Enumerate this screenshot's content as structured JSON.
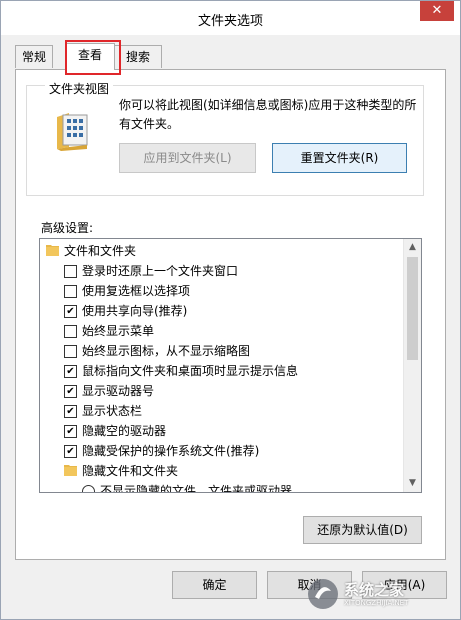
{
  "window": {
    "title": "文件夹选项",
    "close_glyph": "✕"
  },
  "tabs": [
    {
      "label": "常规",
      "active": false
    },
    {
      "label": "查看",
      "active": true
    },
    {
      "label": "搜索",
      "active": false
    }
  ],
  "folder_view": {
    "caption": "文件夹视图",
    "description": "你可以将此视图(如详细信息或图标)应用于这种类型的所有文件夹。",
    "apply_button": "应用到文件夹(L)",
    "reset_button": "重置文件夹(R)"
  },
  "advanced": {
    "label": "高级设置:",
    "items": [
      {
        "type": "folder",
        "indent": 0,
        "label": "文件和文件夹"
      },
      {
        "type": "checkbox",
        "indent": 1,
        "checked": false,
        "label": "登录时还原上一个文件夹窗口"
      },
      {
        "type": "checkbox",
        "indent": 1,
        "checked": false,
        "label": "使用复选框以选择项"
      },
      {
        "type": "checkbox",
        "indent": 1,
        "checked": true,
        "label": "使用共享向导(推荐)"
      },
      {
        "type": "checkbox",
        "indent": 1,
        "checked": false,
        "label": "始终显示菜单"
      },
      {
        "type": "checkbox",
        "indent": 1,
        "checked": false,
        "label": "始终显示图标，从不显示缩略图"
      },
      {
        "type": "checkbox",
        "indent": 1,
        "checked": true,
        "label": "鼠标指向文件夹和桌面项时显示提示信息"
      },
      {
        "type": "checkbox",
        "indent": 1,
        "checked": true,
        "label": "显示驱动器号"
      },
      {
        "type": "checkbox",
        "indent": 1,
        "checked": true,
        "label": "显示状态栏"
      },
      {
        "type": "checkbox",
        "indent": 1,
        "checked": true,
        "label": "隐藏空的驱动器"
      },
      {
        "type": "checkbox",
        "indent": 1,
        "checked": true,
        "label": "隐藏受保护的操作系统文件(推荐)"
      },
      {
        "type": "folder",
        "indent": 1,
        "label": "隐藏文件和文件夹"
      },
      {
        "type": "radio",
        "indent": 2,
        "checked": false,
        "label": "不显示隐藏的文件、文件夹或驱动器"
      }
    ],
    "restore_button": "还原为默认值(D)"
  },
  "footer": {
    "ok_button": "确定",
    "cancel_button": "取消",
    "apply_button": "应用(A)"
  },
  "watermark": {
    "brand": "系统之家",
    "url": "XITONGZHIJIA.NET"
  },
  "colors": {
    "highlight": "#e0262a",
    "close": "#c7413b"
  }
}
